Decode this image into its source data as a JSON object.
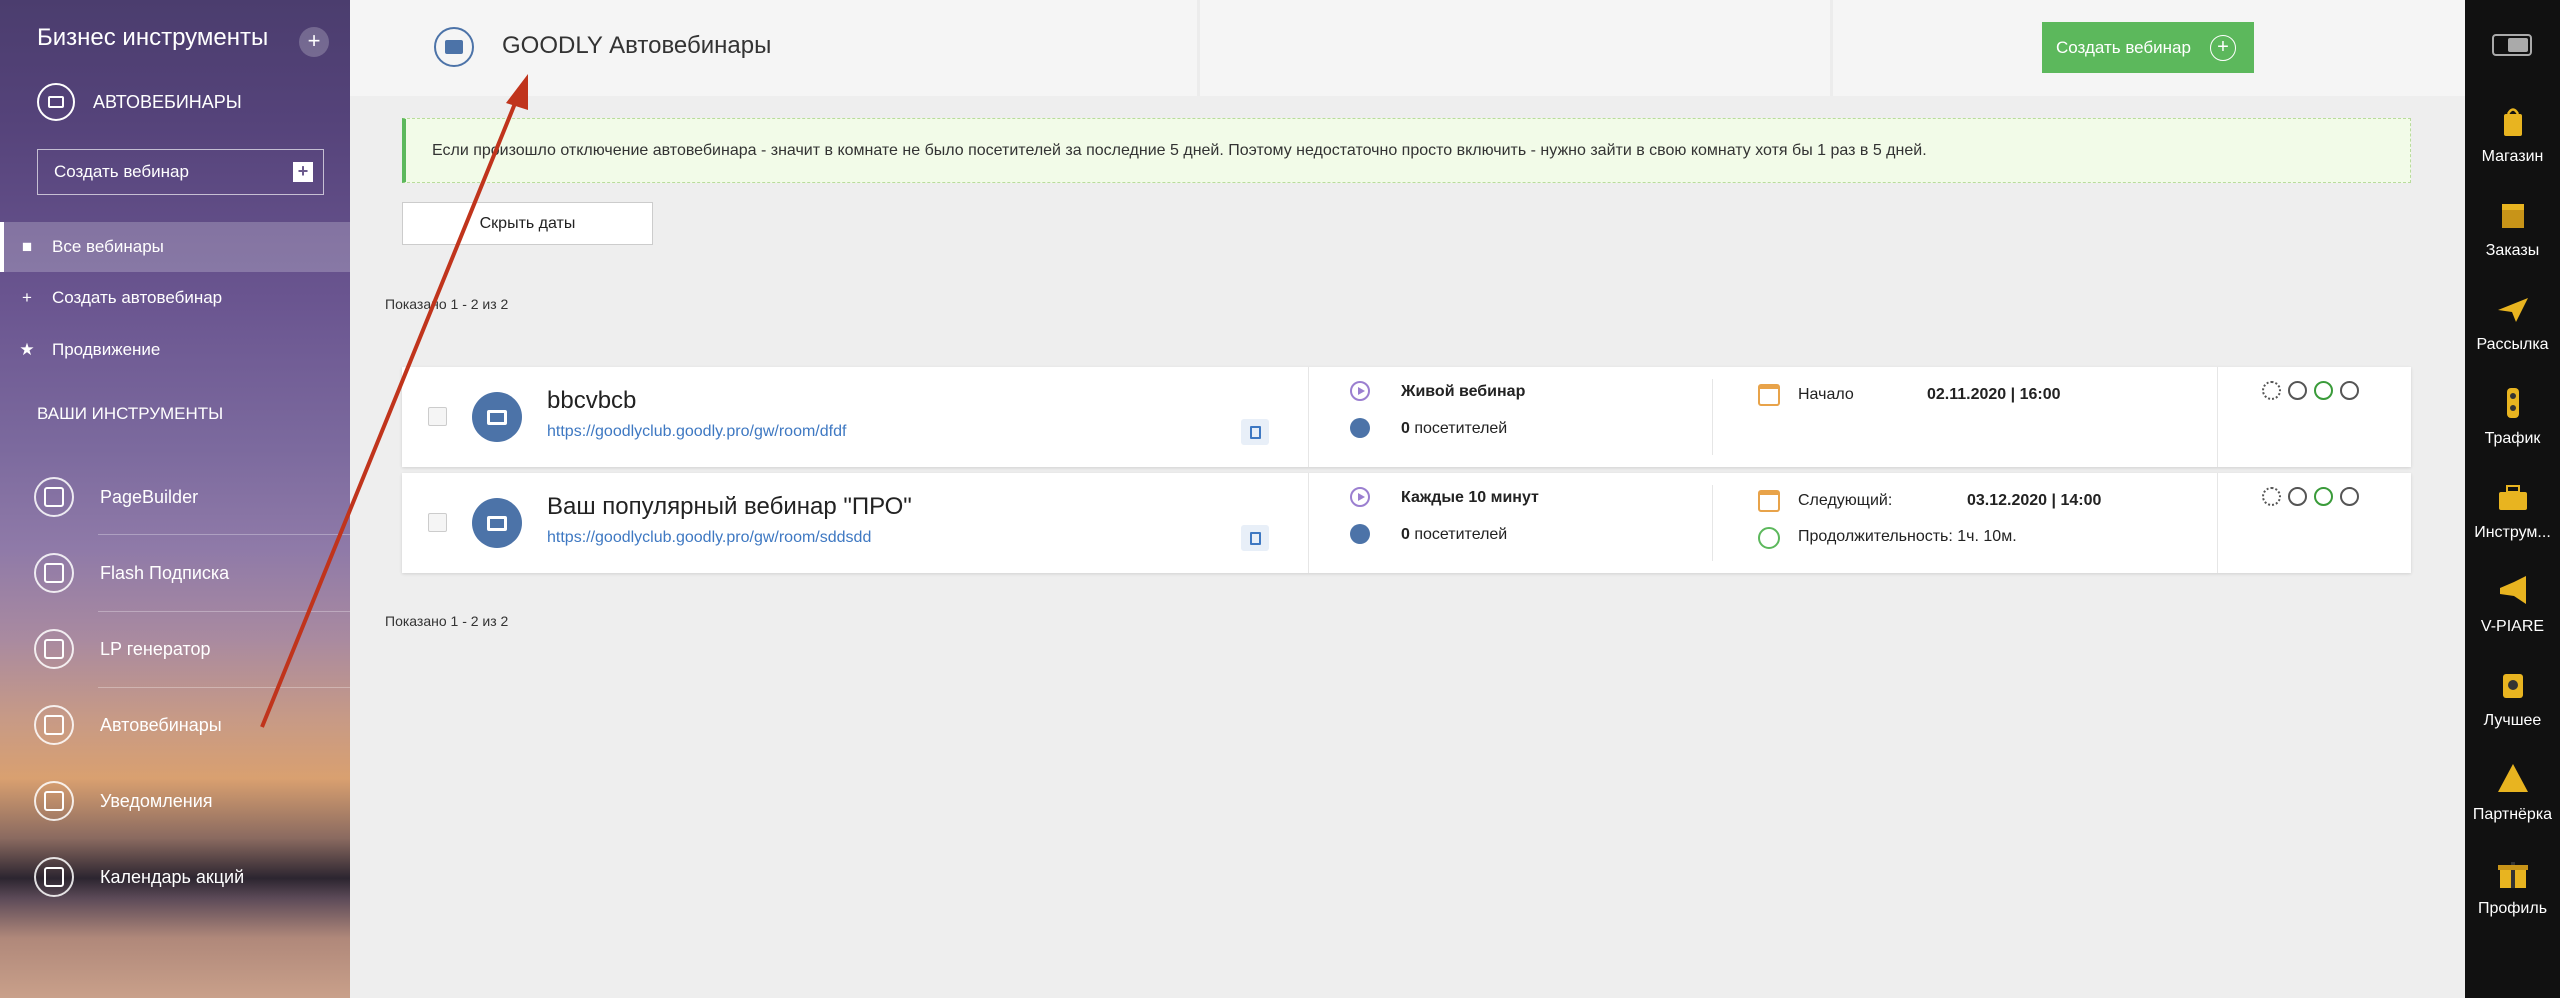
{
  "sidebar": {
    "title": "Бизнес инструменты",
    "plus": "+",
    "section_label": "АВТОВЕБИНАРЫ",
    "create_label": "Создать вебинар",
    "nav": [
      {
        "label": "Все вебинары",
        "icon": "video-camera-icon",
        "glyph": "■"
      },
      {
        "label": "Создать автовебинар",
        "icon": "plus-icon",
        "glyph": "+"
      },
      {
        "label": "Продвижение",
        "icon": "star-icon",
        "glyph": "★"
      }
    ],
    "tools_label": "ВАШИ ИНСТРУМЕНТЫ",
    "tools": [
      {
        "label": "PageBuilder"
      },
      {
        "label": "Flash Подписка"
      },
      {
        "label": "LP генератор"
      },
      {
        "label": "Автовебинары"
      },
      {
        "label": "Уведомления"
      },
      {
        "label": "Календарь акций"
      }
    ]
  },
  "header": {
    "title": "GOODLY Автовебинары",
    "create_label": "Создать вебинар",
    "create_plus": "+"
  },
  "alert": {
    "text": "Если произошло отключение автовебинара - значит в комнате не было посетителей за последние 5 дней. Поэтому недостаточно просто включить - нужно зайти в свою комнату хотя бы 1 раз в 5 дней."
  },
  "hide_dates_label": "Скрыть даты",
  "shown_top": "Показано 1 - 2 из 2",
  "shown_bottom": "Показано 1 - 2 из 2",
  "webinars": [
    {
      "name": "bbcvbcb",
      "url": "https://goodlyclub.goodly.pro/gw/room/dfdf",
      "type": "Живой вебинар",
      "visitors_count": "0",
      "visitors_label": "посетителей",
      "date_label": "Начало",
      "date": "02.11.2020 | 16:00"
    },
    {
      "name": "Ваш популярный вебинар \"ПРО\"",
      "url": "https://goodlyclub.goodly.pro/gw/room/sddsdd",
      "type": "Каждые 10 минут",
      "visitors_count": "0",
      "visitors_label": "посетителей",
      "date_label": "Следующий:",
      "date": "03.12.2020 | 14:00",
      "duration": "Продолжительность: 1ч. 10м."
    }
  ],
  "dock": {
    "items": [
      {
        "label": "Магазин",
        "icon": "shopping-bag-icon",
        "color": "#e8b420"
      },
      {
        "label": "Заказы",
        "icon": "box-icon",
        "color": "#e8b420"
      },
      {
        "label": "Рассылка",
        "icon": "paper-plane-icon",
        "color": "#e8b420"
      },
      {
        "label": "Трафик",
        "icon": "traffic-light-icon",
        "color": "#e8b420"
      },
      {
        "label": "Инструм...",
        "icon": "toolbox-icon",
        "color": "#e8b420"
      },
      {
        "label": "V-PIARE",
        "icon": "megaphone-icon",
        "color": "#e8b420"
      },
      {
        "label": "Лучшее",
        "icon": "cup-icon",
        "color": "#e8b420"
      },
      {
        "label": "Партнёрка",
        "icon": "pyramid-icon",
        "color": "#e8b420"
      },
      {
        "label": "Профиль",
        "icon": "gift-icon",
        "color": "#e8b420"
      }
    ]
  },
  "colors": {
    "accent_green": "#5cb85c",
    "accent_blue": "#4c73a8",
    "link": "#3e78c2",
    "arrow": "#c0341c"
  }
}
